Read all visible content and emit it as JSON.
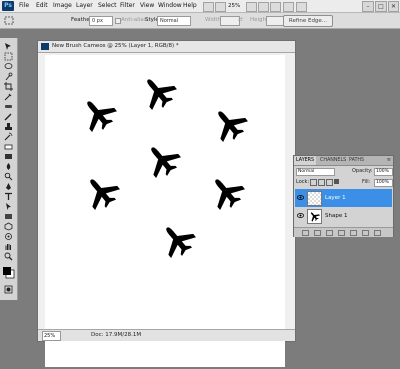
{
  "menubar": {
    "logo": "Ps",
    "items": [
      "File",
      "Edit",
      "Image",
      "Layer",
      "Select",
      "Filter",
      "View",
      "Window",
      "Help"
    ],
    "zoom": "25%"
  },
  "options": {
    "feather_label": "Feather:",
    "feather_value": "0 px",
    "antialias_label": "Anti-alias",
    "style_label": "Style:",
    "style_value": "Normal",
    "width_label": "Width:",
    "height_label": "Height:",
    "refine_label": "Refine Edge..."
  },
  "document": {
    "title": "New Brush Cameos @ 25% (Layer 1, RGB/8) *",
    "zoom": "25%",
    "doc_info": "Doc: 17.9M/28.1M",
    "planes": 7
  },
  "layers_panel": {
    "tabs": [
      "LAYERS",
      "CHANNELS",
      "PATHS"
    ],
    "blend_mode": "Normal",
    "opacity_label": "Opacity:",
    "opacity_value": "100%",
    "lock_label": "Lock:",
    "fill_label": "Fill:",
    "fill_value": "100%",
    "layers": [
      {
        "name": "Layer 1",
        "selected": true
      },
      {
        "name": "Shape 1",
        "selected": false
      }
    ]
  },
  "colors": {
    "selection": "#3c8fe6",
    "panel": "#d3d3d3",
    "workspace": "#7c7c7c"
  }
}
